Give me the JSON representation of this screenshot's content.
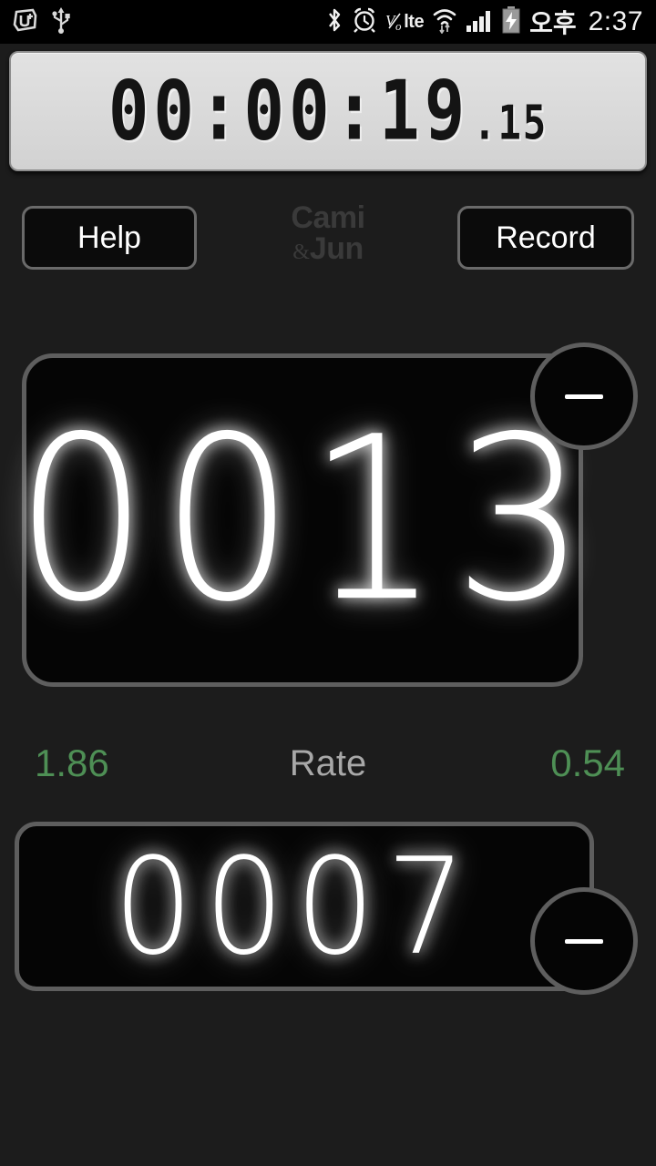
{
  "statusbar": {
    "left_icons": [
      "uplus-app-icon",
      "usb-icon"
    ],
    "right_icons": [
      "bluetooth-icon",
      "alarm-clock-icon",
      "volte-icon",
      "wifi-icon",
      "signal-bars-icon",
      "battery-charging-icon"
    ],
    "volte_label": "lte",
    "ampm": "오후",
    "time": "2:37"
  },
  "timer": {
    "main": "00:00:19",
    "fraction": ".15"
  },
  "toolbar": {
    "help_label": "Help",
    "record_label": "Record"
  },
  "brand": {
    "line1": "Cami",
    "amp": "&",
    "line2": "Jun"
  },
  "counters": {
    "primary": {
      "value": "0013",
      "minus_label": "−"
    },
    "secondary": {
      "value": "0007",
      "minus_label": "−"
    }
  },
  "rate": {
    "left_value": "1.86",
    "label": "Rate",
    "right_value": "0.54"
  },
  "colors": {
    "background": "#1c1c1c",
    "panel_black": "#050505",
    "border_gray": "#5e5e5e",
    "rate_green": "#4e8f55",
    "lcd_face": "#d8d8d8",
    "brand_gray": "#3a3a3a"
  }
}
